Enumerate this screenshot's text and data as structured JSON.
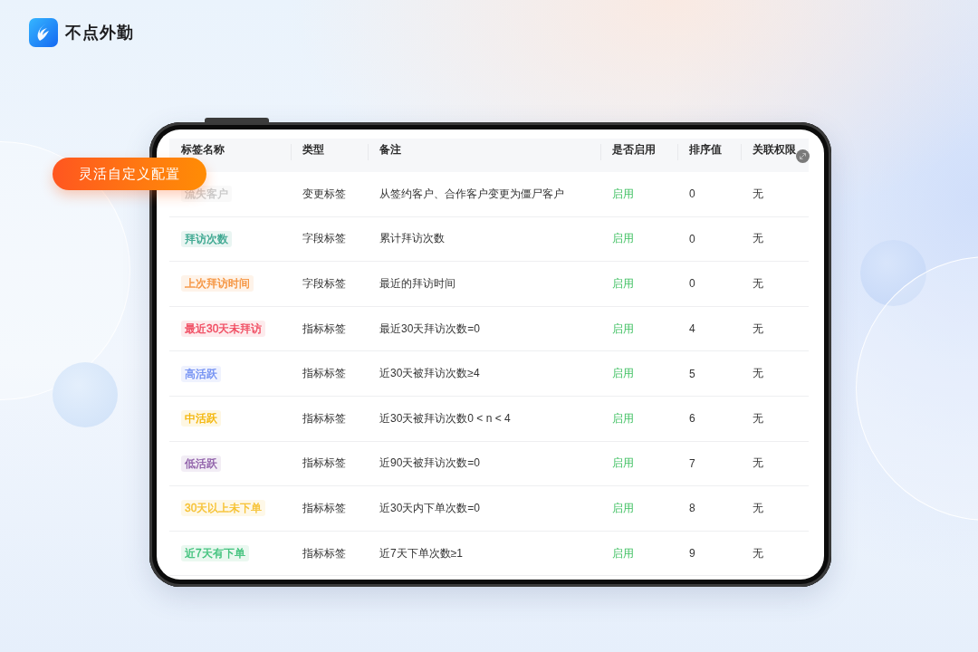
{
  "app": {
    "name": "不点外勤"
  },
  "badge": {
    "label": "灵活自定义配置"
  },
  "table": {
    "columns": [
      "标签名称",
      "类型",
      "备注",
      "是否启用",
      "排序值",
      "关联权限"
    ],
    "rows": [
      {
        "tag": {
          "label": "流失客户",
          "color": "#c8c8c8"
        },
        "type": "变更标签",
        "note": "从签约客户、合作客户变更为僵尸客户",
        "status": "启用",
        "enabled": true,
        "sort": "0",
        "permission": "无"
      },
      {
        "tag": {
          "label": "拜访次数",
          "color": "#35a48c"
        },
        "type": "字段标签",
        "note": "累计拜访次数",
        "status": "启用",
        "enabled": true,
        "sort": "0",
        "permission": "无"
      },
      {
        "tag": {
          "label": "上次拜访时间",
          "color": "#f5913a"
        },
        "type": "字段标签",
        "note": "最近的拜访时间",
        "status": "启用",
        "enabled": true,
        "sort": "0",
        "permission": "无"
      },
      {
        "tag": {
          "label": "最近30天未拜访",
          "color": "#f0465c"
        },
        "type": "指标标签",
        "note": "最近30天拜访次数=0",
        "status": "启用",
        "enabled": true,
        "sort": "4",
        "permission": "无"
      },
      {
        "tag": {
          "label": "高活跃",
          "color": "#6d8cf2"
        },
        "type": "指标标签",
        "note": "近30天被拜访次数≥4",
        "status": "启用",
        "enabled": true,
        "sort": "5",
        "permission": "无"
      },
      {
        "tag": {
          "label": "中活跃",
          "color": "#f3b400"
        },
        "type": "指标标签",
        "note": "近30天被拜访次数0 < n < 4",
        "status": "启用",
        "enabled": true,
        "sort": "6",
        "permission": "无"
      },
      {
        "tag": {
          "label": "低活跃",
          "color": "#8b5aa6"
        },
        "type": "指标标签",
        "note": "近90天被拜访次数=0",
        "status": "启用",
        "enabled": true,
        "sort": "7",
        "permission": "无"
      },
      {
        "tag": {
          "label": "30天以上未下单",
          "color": "#f6c02e"
        },
        "type": "指标标签",
        "note": "近30天内下单次数=0",
        "status": "启用",
        "enabled": true,
        "sort": "8",
        "permission": "无"
      },
      {
        "tag": {
          "label": "近7天有下单",
          "color": "#3cc079"
        },
        "type": "指标标签",
        "note": "近7天下单次数≥1",
        "status": "启用",
        "enabled": true,
        "sort": "9",
        "permission": "无"
      }
    ]
  }
}
